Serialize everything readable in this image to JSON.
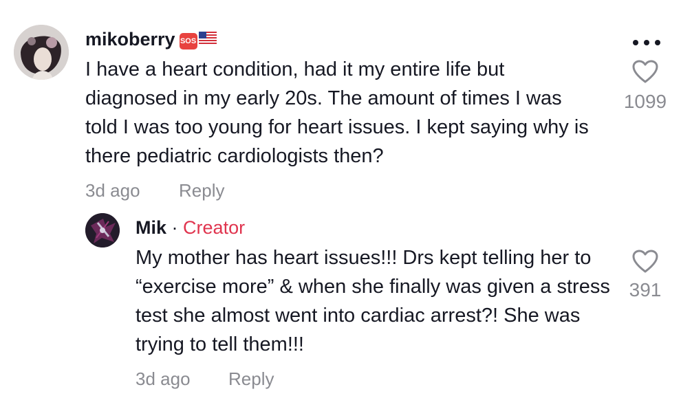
{
  "comments": [
    {
      "username": "mikoberry",
      "badge_sos": "SOS",
      "badge_colors": {
        "sos_bg": "#e8423f",
        "flag_red": "#d22f3a",
        "flag_blue": "#2c3f8f"
      },
      "text": "I have a heart condition, had it my entire life but diagnosed in my early 20s. The amount of times I was told I was too young for heart issues. I kept saying why is there pediatric cardiologists then?",
      "time": "3d ago",
      "reply_label": "Reply",
      "likes": "1099",
      "like_icon": "heart-outline-icon",
      "more_icon": "more-dots-icon"
    },
    {
      "username": "Mik",
      "separator": "·",
      "creator_label": "Creator",
      "creator_color": "#e0344e",
      "text": "My mother has heart issues!!! Drs kept telling her to “exercise more” & when she finally was given a stress test she almost went into cardiac arrest?! She was trying to tell them!!!",
      "time": "3d ago",
      "reply_label": "Reply",
      "likes": "391",
      "like_icon": "heart-outline-icon"
    }
  ]
}
